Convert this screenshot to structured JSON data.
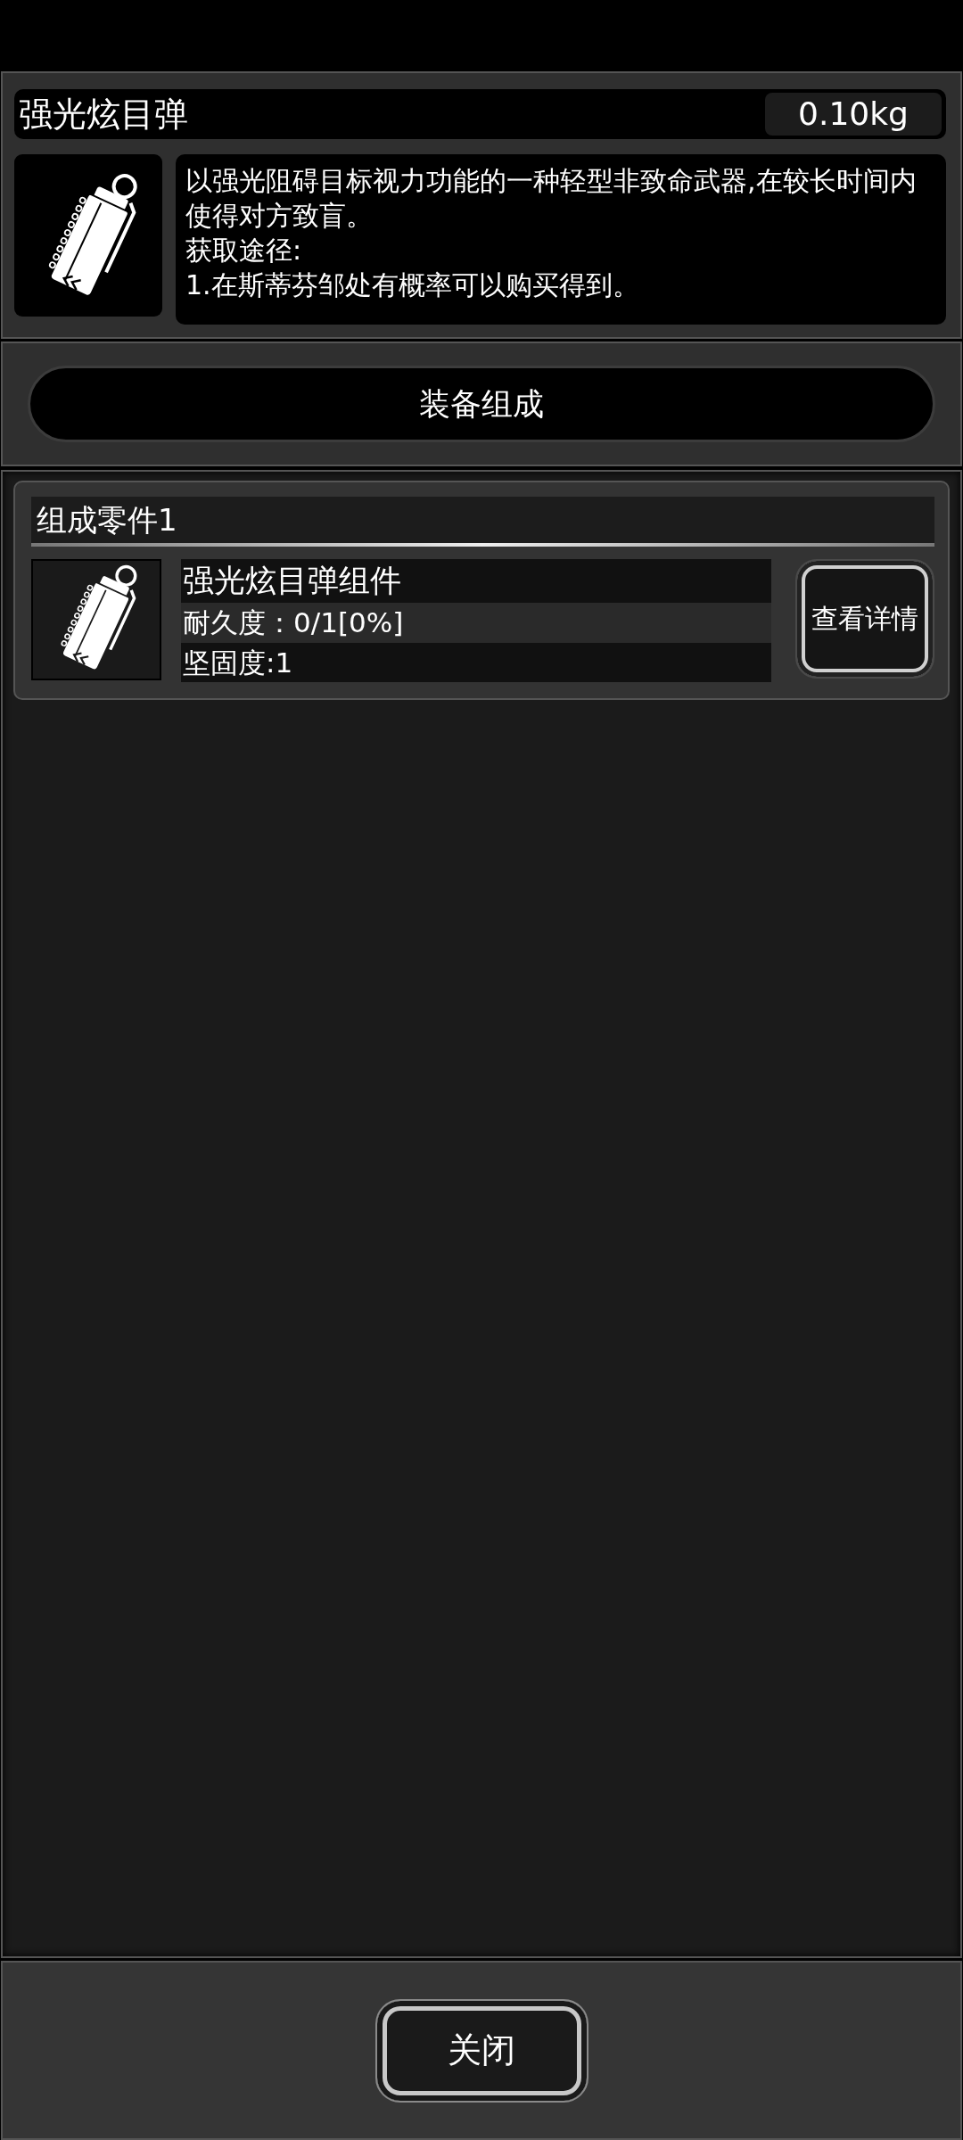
{
  "item": {
    "name": "强光炫目弹",
    "weight": "0.10kg",
    "description": [
      "以强光阻碍目标视力功能的一种轻型非致命武器,在较长时间内使得对方致盲。",
      "获取途径:",
      "1.在斯蒂芬邹处有概率可以购买得到。"
    ]
  },
  "composition_button": {
    "label": "装备组成"
  },
  "components": [
    {
      "title": "组成零件1",
      "name": "强光炫目弹组件",
      "durability": "耐久度：0/1[0%]",
      "hardness": "坚固度:1",
      "button": "查看详情"
    }
  ],
  "close_button": {
    "label": "关闭"
  }
}
